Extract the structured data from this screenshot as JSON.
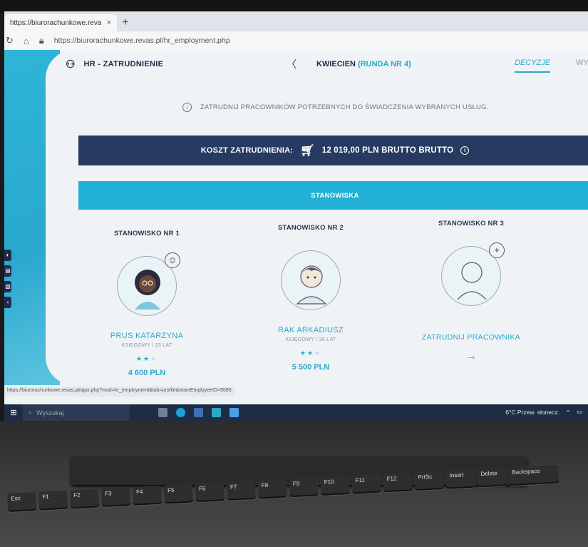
{
  "browser": {
    "tab_title": "https://biurorachunkowe.revas.p",
    "tab_close": "×",
    "new_tab": "+",
    "url": "https://biurorachunkowe.revas.pl/hr_employment.php"
  },
  "topnav": {
    "title": "HR - ZATRUDNIENIE",
    "month": "KWIECIEN",
    "round": "(RUNDA NR 4)",
    "tab_active": "DECYZJE",
    "tab_next": "WY"
  },
  "info_text": "ZATRUDNIJ PRACOWNIKÓW POTRZEBNYCH DO ŚWIADCZENIA WYBRANYCH USŁUG.",
  "cost": {
    "label": "KOSZT ZATRUDNIENIA:",
    "value": "12 019,00 PLN BRUTTO BRUTTO"
  },
  "section_title": "STANOWISKA",
  "slots": [
    {
      "label": "STANOWISKO NR 1",
      "name": "PRUS KATARZYNA",
      "role": "KSIĘGOWY / 25 LAT",
      "stars_on": "★★",
      "stars_off": "★",
      "salary": "4 600 PLN"
    },
    {
      "label": "STANOWISKO NR 2",
      "name": "RAK ARKADIUSZ",
      "role": "KSIĘGOWY / 30 LAT",
      "stars_on": "★★",
      "stars_off": "★",
      "salary": "5 500 PLN"
    },
    {
      "label": "STANOWISKO NR 3",
      "hire_label": "ZATRUDNIJ PRACOWNIKA",
      "arrow": "→"
    }
  ],
  "status_url": "https://biurorachunkowe.revas.pl/ajax.php?mod=hr_employment&tab=profile&teamEmployeeID=9585",
  "taskbar": {
    "search": "Wyszukaj",
    "weather": "6°C Przew. słonecz."
  },
  "keyboard": [
    "Esc",
    "F1",
    "F2",
    "F3",
    "F4",
    "F5",
    "F6",
    "F7",
    "F8",
    "F9",
    "F10",
    "F11",
    "F12",
    "PrtSc",
    "Insert",
    "Delete",
    "Backspace"
  ]
}
